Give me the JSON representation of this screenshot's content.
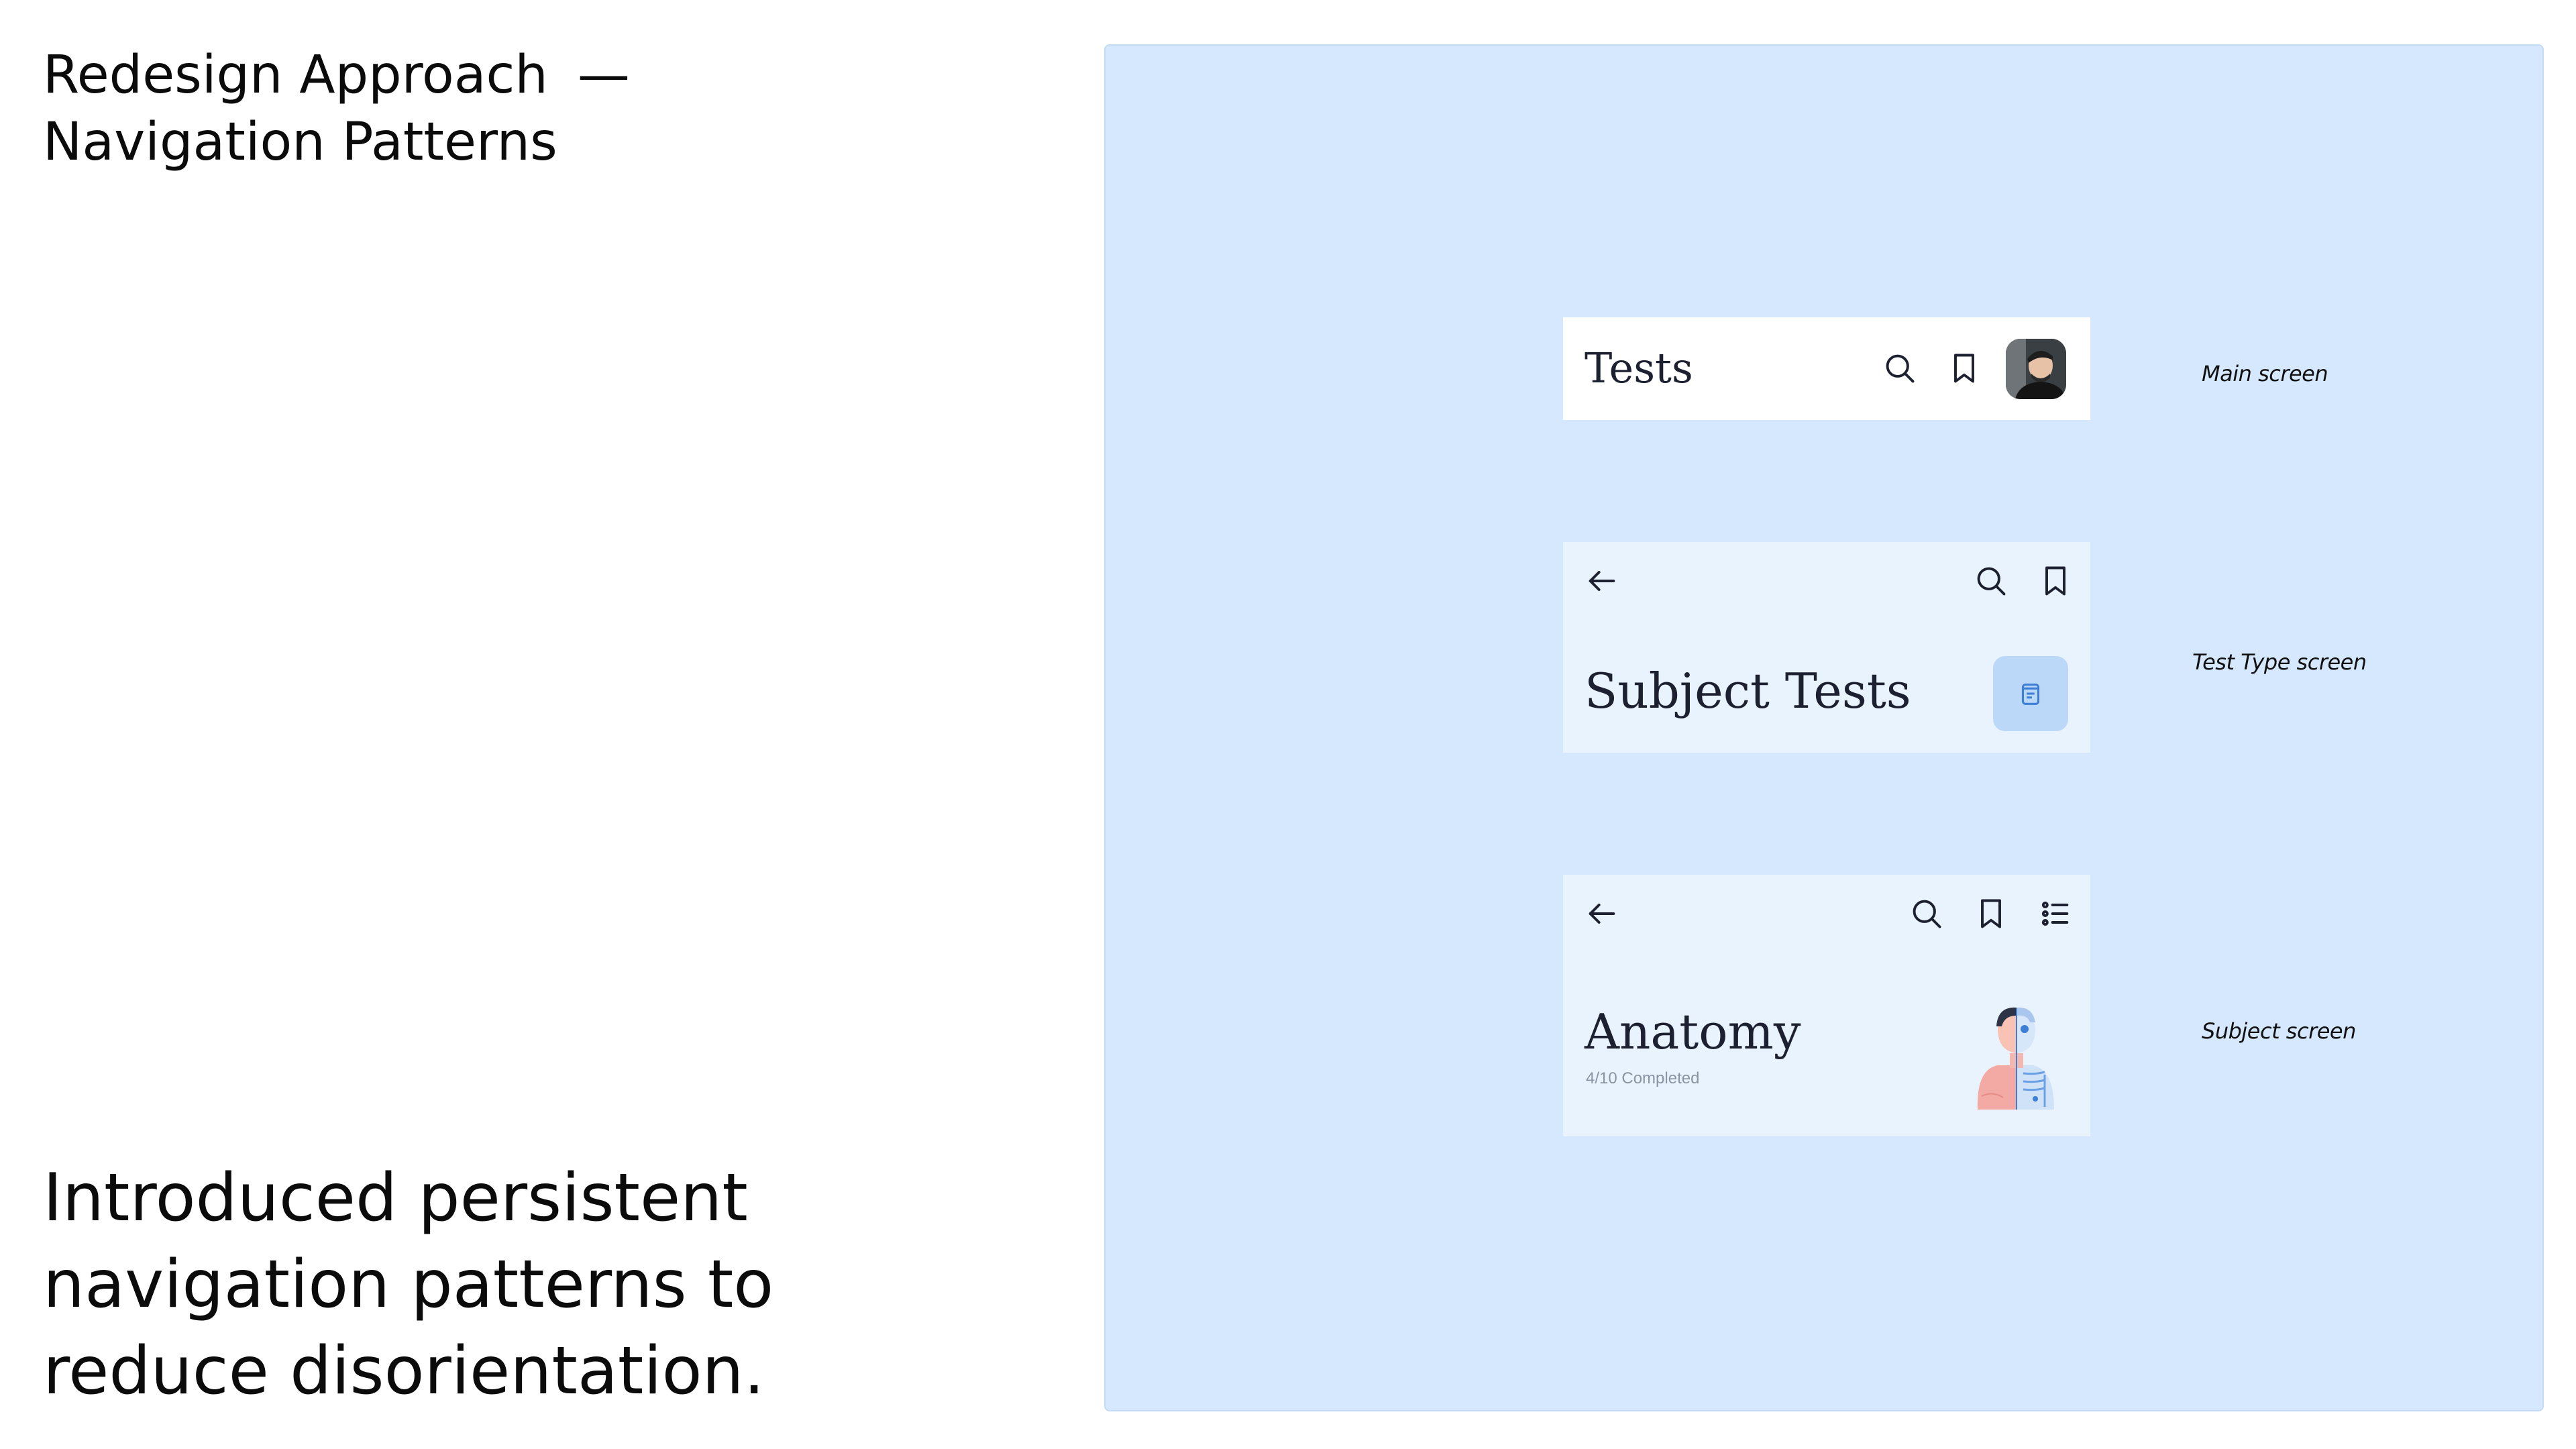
{
  "header": {
    "title_line1": "Redesign Approach",
    "title_dash": "—",
    "title_line2": "Navigation Patterns"
  },
  "lead": {
    "line1": "Introduced persistent",
    "line2": "navigation patterns to",
    "line3": "reduce disorientation."
  },
  "screens": {
    "main": {
      "title": "Tests",
      "annotation": "Main screen",
      "icons": [
        "search-icon",
        "bookmark-icon",
        "avatar"
      ]
    },
    "test_type": {
      "title": "Subject Tests",
      "annotation": "Test Type screen",
      "icons": [
        "back-arrow-icon",
        "search-icon",
        "bookmark-icon",
        "document-icon"
      ]
    },
    "subject": {
      "title": "Anatomy",
      "progress": "4/10 Completed",
      "annotation": "Subject screen",
      "icons": [
        "back-arrow-icon",
        "search-icon",
        "bookmark-icon",
        "list-icon",
        "anatomy-illustration"
      ]
    }
  },
  "colors": {
    "panel_bg": "#d6e8fd",
    "card_bg": "#e9f3fe",
    "accent": "#4a8fe0"
  }
}
